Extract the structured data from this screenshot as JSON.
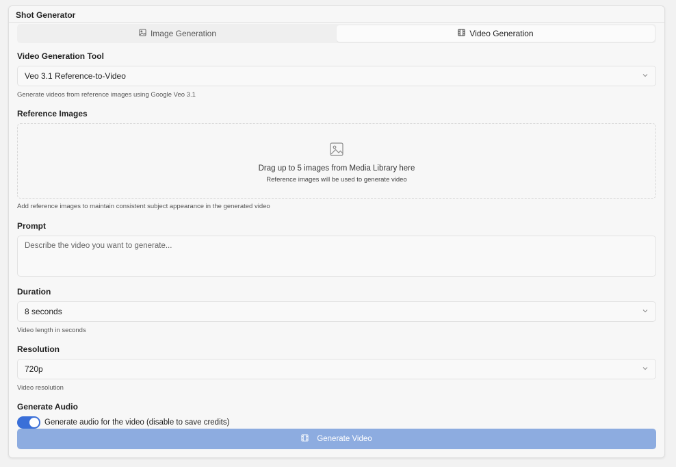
{
  "panel": {
    "title": "Shot Generator"
  },
  "tabs": [
    {
      "label": "Image Generation",
      "icon": "image-icon",
      "active": false
    },
    {
      "label": "Video Generation",
      "icon": "film-icon",
      "active": true
    }
  ],
  "tool": {
    "label": "Video Generation Tool",
    "value": "Veo 3.1 Reference-to-Video",
    "hint": "Generate videos from reference images using Google Veo 3.1"
  },
  "reference": {
    "label": "Reference Images",
    "drop_title": "Drag up to 5 images from Media Library here",
    "drop_subtitle": "Reference images will be used to generate video",
    "hint": "Add reference images to maintain consistent subject appearance in the generated video"
  },
  "prompt": {
    "label": "Prompt",
    "placeholder": "Describe the video you want to generate..."
  },
  "duration": {
    "label": "Duration",
    "value": "8 seconds",
    "hint": "Video length in seconds"
  },
  "resolution": {
    "label": "Resolution",
    "value": "720p",
    "hint": "Video resolution"
  },
  "audio": {
    "label": "Generate Audio",
    "toggle_label": "Generate audio for the video (disable to save credits)",
    "enabled": true
  },
  "generate_button": {
    "label": "Generate Video",
    "icon": "film-icon"
  },
  "colors": {
    "accent": "#3a6fd8",
    "button_disabled": "#8dace0"
  }
}
